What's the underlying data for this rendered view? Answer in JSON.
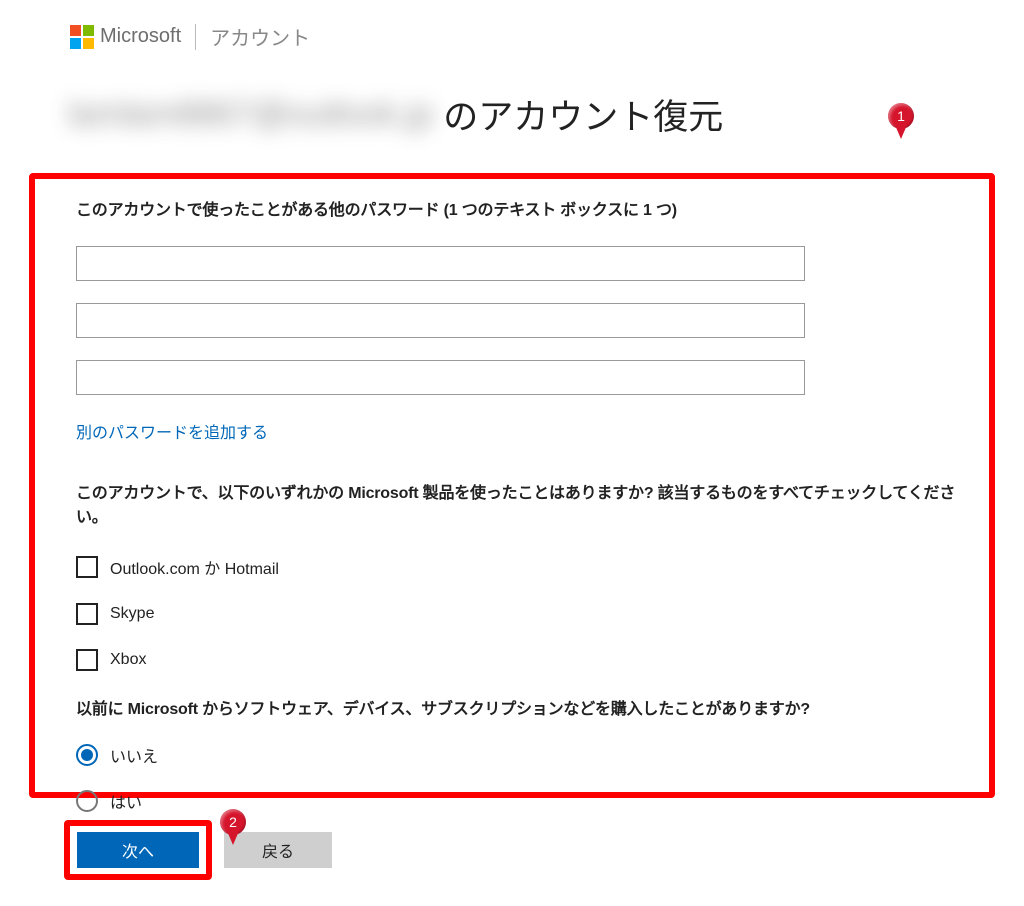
{
  "header": {
    "brand": "Microsoft",
    "section": "アカウント"
  },
  "title": {
    "blurred_email": "lamlam8867@outlook.jp",
    "suffix": "のアカウント復元"
  },
  "form": {
    "passwords_question": "このアカウントで使ったことがある他のパスワード (1 つのテキスト ボックスに 1 つ)",
    "password_values": [
      "",
      "",
      ""
    ],
    "add_password_link": "別のパスワードを追加する",
    "products_question": "このアカウントで、以下のいずれかの Microsoft 製品を使ったことはありますか? 該当するものをすべてチェックしてください。",
    "products": [
      {
        "label": "Outlook.com か Hotmail",
        "checked": false
      },
      {
        "label": "Skype",
        "checked": false
      },
      {
        "label": "Xbox",
        "checked": false
      }
    ],
    "purchase_question": "以前に Microsoft からソフトウェア、デバイス、サブスクリプションなどを購入したことがありますか?",
    "purchase_options": [
      {
        "label": "いいえ",
        "selected": true
      },
      {
        "label": "はい",
        "selected": false
      }
    ]
  },
  "buttons": {
    "next": "次へ",
    "back": "戻る"
  },
  "annotations": {
    "pin1": "1",
    "pin2": "2"
  }
}
